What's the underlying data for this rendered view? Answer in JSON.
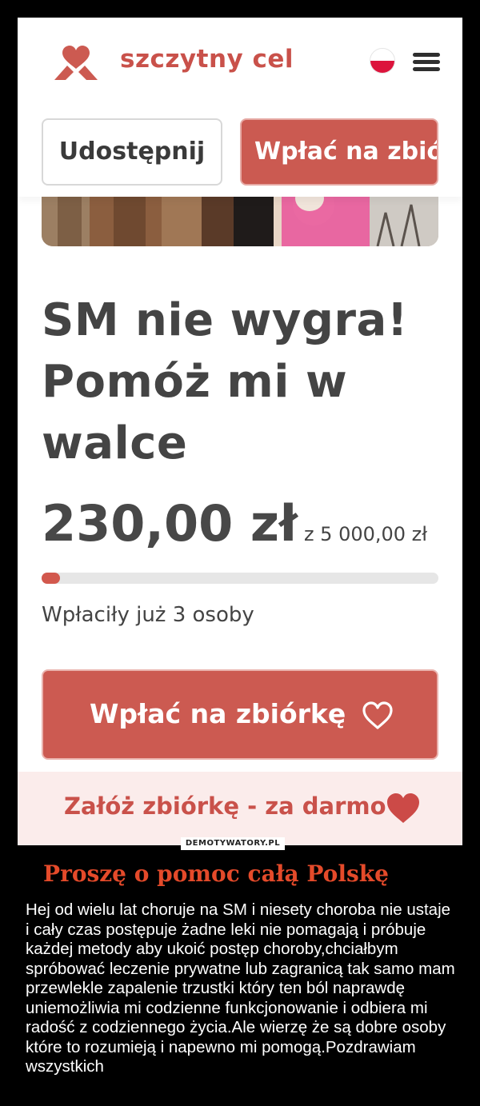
{
  "header": {
    "brand": "szczytny cel",
    "logo_icon": "heart-logo-icon",
    "flag_icon": "poland-flag-icon",
    "menu_icon": "hamburger-menu-icon"
  },
  "actions": {
    "share_label": "Udostępnij",
    "donate_label": "Wpłać na zbiórkę"
  },
  "campaign": {
    "title": "SM nie wygra! Pomóż mi w walce",
    "raised": "230,00 zł",
    "goal": "z 5 000,00 zł",
    "progress": 0.046,
    "donors": "Wpłaciły już 3 osoby",
    "donate_button": "Wpłać na zbiórkę",
    "create_fundraiser": "Załóż zbiórkę - za darmo"
  },
  "colors": {
    "brand": "#c9514a",
    "button": "#cc5a51",
    "banner": "#fbeceb",
    "caption_title": "#e44a2a"
  },
  "watermark": "DEMOTYWATORY.PL",
  "caption": {
    "title": "Proszę o pomoc całą Polskę",
    "text": "Hej od wielu lat choruje na SM i niesety choroba nie ustaje i cały czas postępuje żadne leki nie pomagają i próbuje każdej metody aby ukoić postęp choroby,chciałbym spróbować leczenie prywatne lub zagranicą tak samo mam przewlekle zapalenie trzustki który ten ból naprawdę uniemożliwia mi codzienne funkcjonowanie i odbiera mi radość z codziennego życia.Ale wierzę że są dobre osoby które to rozumieją i napewno mi pomogą.Pozdrawiam wszystkich"
  }
}
